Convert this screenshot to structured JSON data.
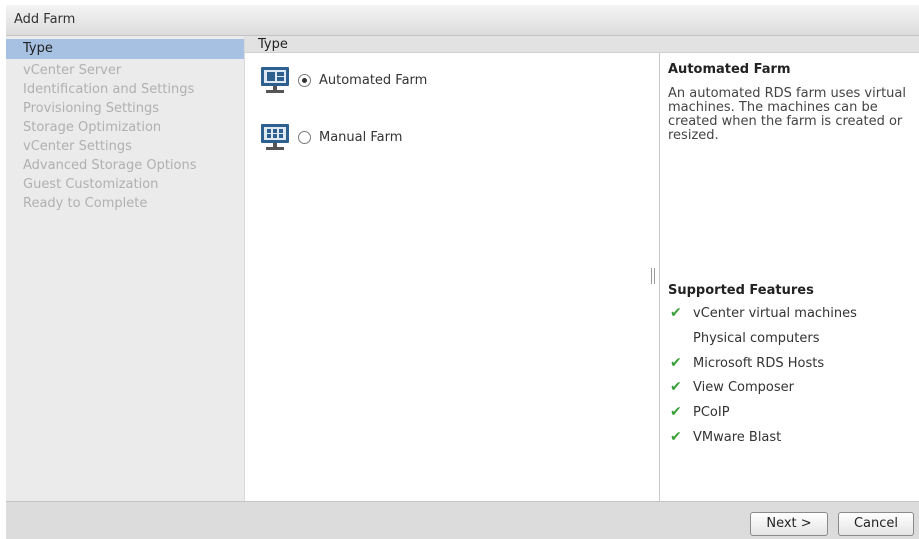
{
  "window": {
    "title": "Add Farm"
  },
  "nav": {
    "items": [
      {
        "label": "Type",
        "active": true
      },
      {
        "label": "vCenter Server"
      },
      {
        "label": "Identification and Settings"
      },
      {
        "label": "Provisioning Settings"
      },
      {
        "label": "Storage Optimization"
      },
      {
        "label": "vCenter Settings"
      },
      {
        "label": "Advanced Storage Options"
      },
      {
        "label": "Guest Customization"
      },
      {
        "label": "Ready to Complete"
      }
    ]
  },
  "main": {
    "header": "Type",
    "options": [
      {
        "label": "Automated Farm",
        "selected": true,
        "icon": "automated-farm-icon"
      },
      {
        "label": "Manual Farm",
        "selected": false,
        "icon": "manual-farm-icon"
      }
    ]
  },
  "info": {
    "title": "Automated Farm",
    "description": "An automated RDS farm uses virtual machines. The machines can be created when the farm is created or resized.",
    "features_title": "Supported Features",
    "features": [
      {
        "label": "vCenter virtual machines",
        "supported": true
      },
      {
        "label": "Physical computers",
        "supported": false
      },
      {
        "label": "Microsoft RDS Hosts",
        "supported": true
      },
      {
        "label": "View Composer",
        "supported": true
      },
      {
        "label": "PCoIP",
        "supported": true
      },
      {
        "label": "VMware Blast",
        "supported": true
      }
    ]
  },
  "footer": {
    "next_label": "Next >",
    "cancel_label": "Cancel"
  },
  "colors": {
    "check": "#3aa03a",
    "nav_active": "#a6c1e2",
    "nav_bg": "#ebebeb"
  }
}
